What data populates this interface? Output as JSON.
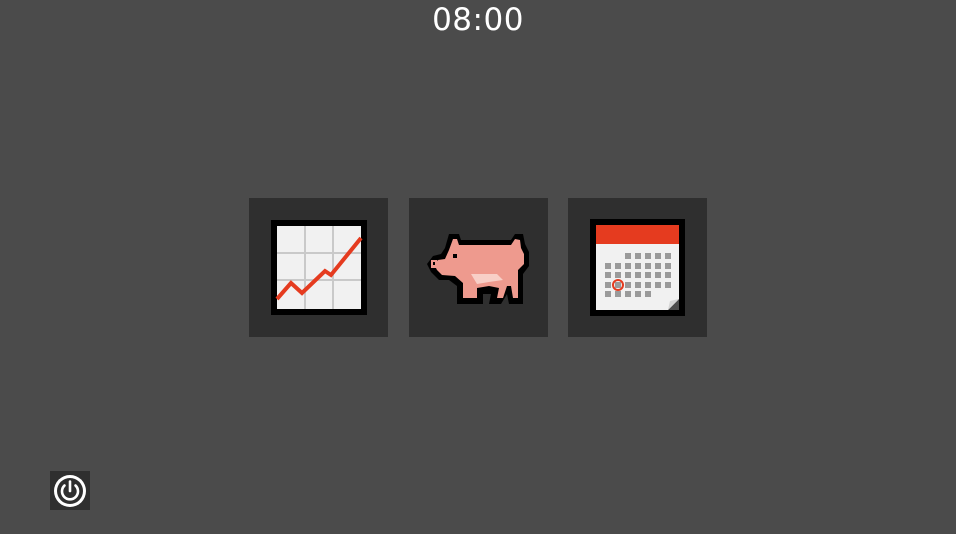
{
  "status_bar": {
    "time": "08:00"
  },
  "apps": [
    {
      "icon": "stock-chart-icon"
    },
    {
      "icon": "pig-icon"
    },
    {
      "icon": "calendar-icon"
    }
  ],
  "system": {
    "power_icon": "power-icon"
  },
  "colors": {
    "background": "#4b4b4b",
    "tile": "#2f2f2f",
    "accent_red": "#e53b1f",
    "pig_pink": "#ee9a8e"
  }
}
